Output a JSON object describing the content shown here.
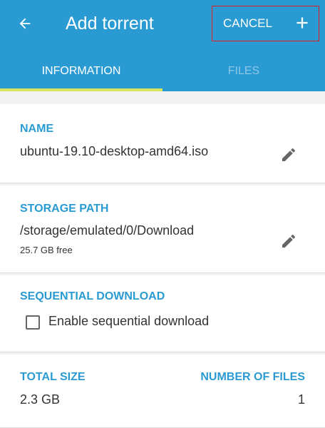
{
  "header": {
    "title": "Add torrent",
    "cancel_label": "CANCEL",
    "back_icon": "arrow-left-icon",
    "add_icon": "plus-icon",
    "bg_color": "#2a9bd2",
    "highlight_color": "#e0201c"
  },
  "tabs": [
    {
      "label": "INFORMATION",
      "active": true
    },
    {
      "label": "FILES",
      "active": false
    }
  ],
  "name_section": {
    "label": "NAME",
    "value": "ubuntu-19.10-desktop-amd64.iso",
    "edit_icon": "pencil-icon"
  },
  "storage_section": {
    "label": "STORAGE PATH",
    "value": "/storage/emulated/0/Download",
    "free": "25.7 GB free",
    "edit_icon": "pencil-icon"
  },
  "sequential_section": {
    "label": "SEQUENTIAL DOWNLOAD",
    "checkbox_label": "Enable sequential download",
    "checked": false
  },
  "size_section": {
    "total_size_label": "TOTAL SIZE",
    "total_size_value": "2.3 GB",
    "num_files_label": "NUMBER OF FILES",
    "num_files_value": "1"
  }
}
